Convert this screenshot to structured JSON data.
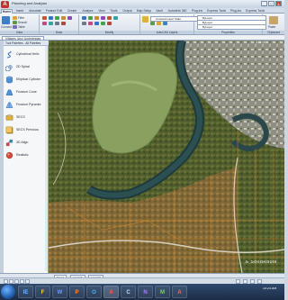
{
  "window": {
    "title": "Planning and Analysis",
    "app_letter": "A",
    "minimize_glyph": "_",
    "maximize_glyph": "□",
    "close_glyph": "x"
  },
  "ribbon": {
    "tabs": [
      "Home",
      "Insert",
      "Annotate",
      "Feature Edit",
      "Create",
      "Analyze",
      "View",
      "Tools",
      "Output",
      "Map Setup",
      "Vault",
      "Autodesk 360",
      "Plug-ins",
      "Express Tools",
      "Plug-ins",
      "Express Tools"
    ],
    "active_tab": 0,
    "panels": [
      {
        "label": "Data",
        "tools": [
          "Connect",
          "Filter",
          "Search",
          "Table"
        ]
      },
      {
        "label": "Draw",
        "tools": []
      },
      {
        "label": "Modify",
        "tools": []
      },
      {
        "label": "AutoCAD Layers",
        "tools": [
          "Unsaved Layer State"
        ]
      },
      {
        "label": "Properties",
        "tools": [
          "ByLayer",
          "ByLayer",
          "ByLayer"
        ]
      },
      {
        "label": "Clipboard",
        "tools": [
          "Paste"
        ]
      }
    ]
  },
  "document": {
    "tab_label": "Villages (Arc) Andmendag"
  },
  "tool_palette": {
    "header": "Tool Palettes - All Palettes",
    "items": [
      {
        "label": "Cylindrical Helix",
        "icon": "helix-icon"
      },
      {
        "label": "2D Spiral",
        "icon": "spiral-icon"
      },
      {
        "label": "Elliptical Cylinder",
        "icon": "cylinder-icon"
      },
      {
        "label": "Frustum Cone",
        "icon": "cone-icon"
      },
      {
        "label": "Frustum Pyramid",
        "icon": "pyramid-icon"
      },
      {
        "label": "SECS",
        "icon": "secs-icon"
      },
      {
        "label": "SECS Previous",
        "icon": "secs-previous-icon"
      },
      {
        "label": "3D Align",
        "icon": "align-3d-icon"
      },
      {
        "label": "Realistic",
        "icon": "realistic-icon"
      }
    ]
  },
  "viewport": {
    "coords": "N 41 55",
    "watermark": "♨ SolidRoute"
  },
  "layout_tabs": [
    "Model",
    "Layout1",
    "Layout2"
  ],
  "taskbar": {
    "apps": [
      "IE",
      "F",
      "W",
      "P",
      "O",
      "A",
      "C",
      "N",
      "M",
      "A"
    ],
    "clock": "10:24 AM"
  },
  "colors": {
    "accent": "#c9302c",
    "ribbon": "#dbe4ef",
    "taskbar": "#23395a"
  }
}
